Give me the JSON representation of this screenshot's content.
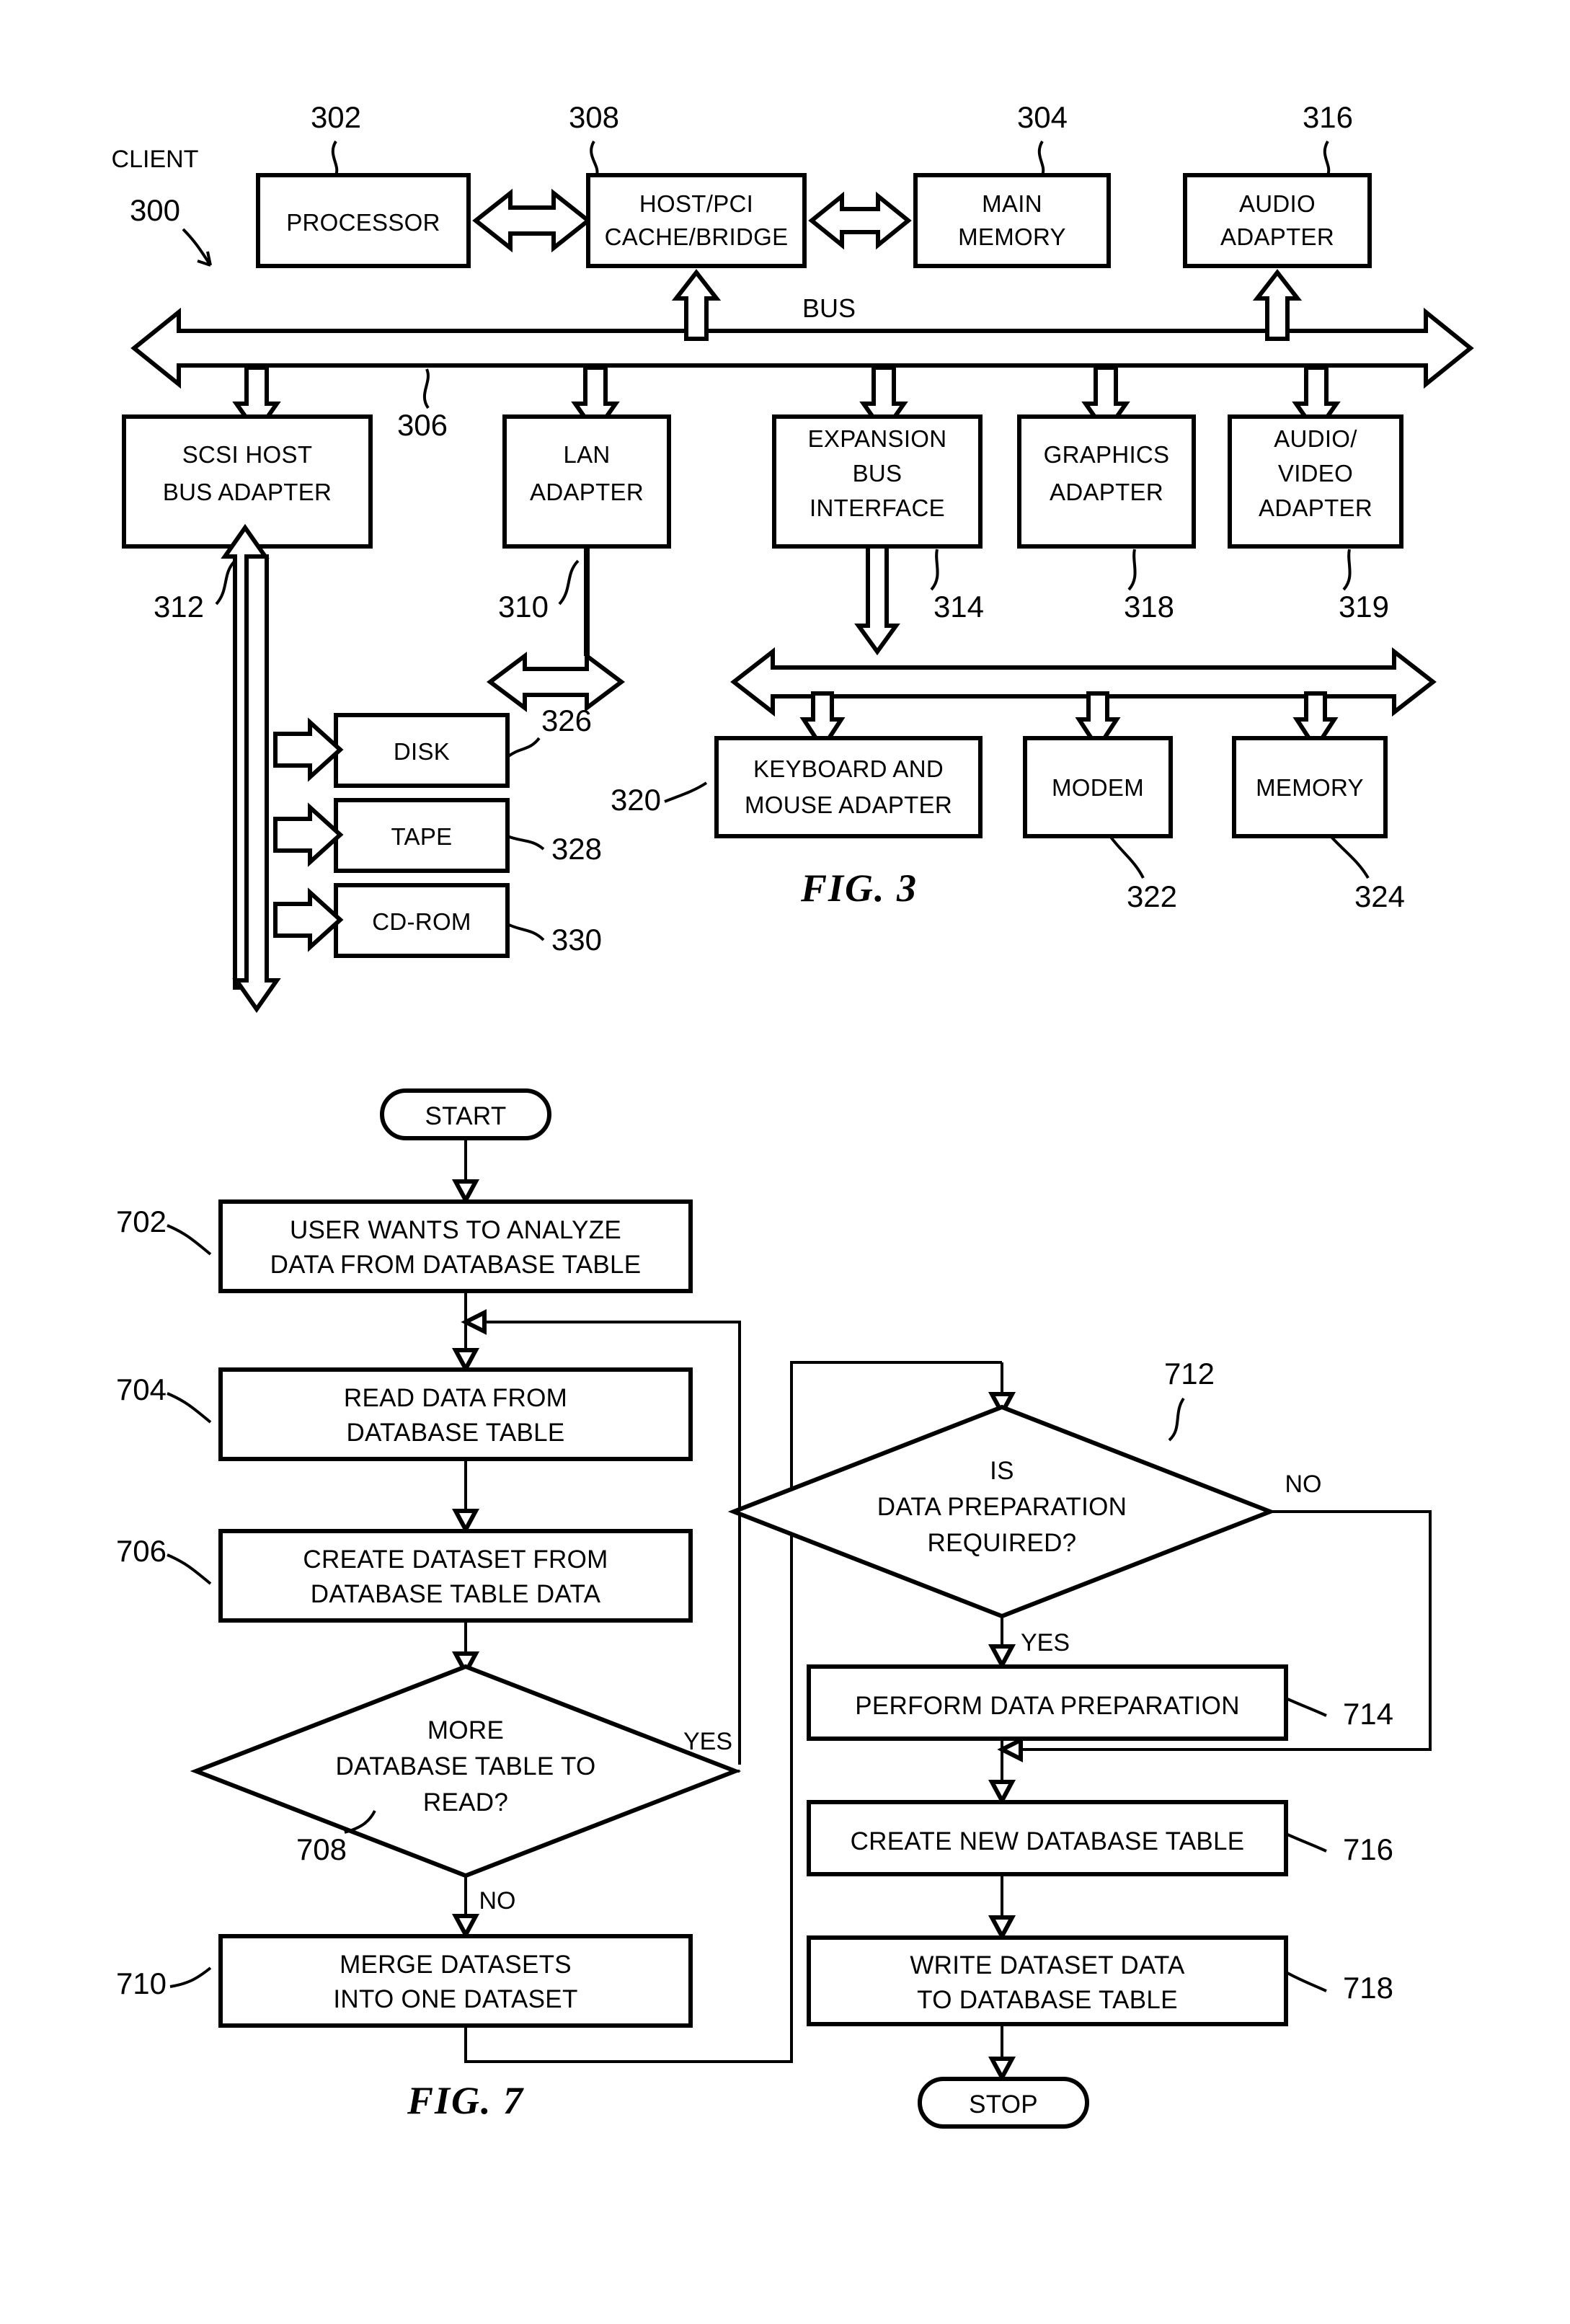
{
  "figures": [
    {
      "id": "fig3",
      "caption": "FIG. 3",
      "system_label": "CLIENT",
      "system_ref": "300",
      "bus_label": "BUS",
      "bus_ref": "306",
      "nodes": [
        {
          "key": "processor",
          "label_lines": [
            "PROCESSOR"
          ],
          "ref": "302"
        },
        {
          "key": "hostpci",
          "label_lines": [
            "HOST/PCI",
            "CACHE/BRIDGE"
          ],
          "ref": "308"
        },
        {
          "key": "mainmemory",
          "label_lines": [
            "MAIN",
            "MEMORY"
          ],
          "ref": "304"
        },
        {
          "key": "audioadapter",
          "label_lines": [
            "AUDIO",
            "ADAPTER"
          ],
          "ref": "316"
        },
        {
          "key": "scsi",
          "label_lines": [
            "SCSI HOST",
            "BUS ADAPTER"
          ],
          "ref": "312"
        },
        {
          "key": "lan",
          "label_lines": [
            "LAN",
            "ADAPTER"
          ],
          "ref": "310"
        },
        {
          "key": "expansion",
          "label_lines": [
            "EXPANSION",
            "BUS",
            "INTERFACE"
          ],
          "ref": "314"
        },
        {
          "key": "graphics",
          "label_lines": [
            "GRAPHICS",
            "ADAPTER"
          ],
          "ref": "318"
        },
        {
          "key": "audiovideo",
          "label_lines": [
            "AUDIO/",
            "VIDEO",
            "ADAPTER"
          ],
          "ref": "319"
        },
        {
          "key": "disk",
          "label_lines": [
            "DISK"
          ],
          "ref": "326"
        },
        {
          "key": "tape",
          "label_lines": [
            "TAPE"
          ],
          "ref": "328"
        },
        {
          "key": "cdrom",
          "label_lines": [
            "CD-ROM"
          ],
          "ref": "330"
        },
        {
          "key": "keyboard",
          "label_lines": [
            "KEYBOARD AND",
            "MOUSE ADAPTER"
          ],
          "ref": "320"
        },
        {
          "key": "modem",
          "label_lines": [
            "MODEM"
          ],
          "ref": "322"
        },
        {
          "key": "memory",
          "label_lines": [
            "MEMORY"
          ],
          "ref": "324"
        }
      ]
    },
    {
      "id": "fig7",
      "caption": "FIG. 7",
      "terminators": {
        "start": "START",
        "stop": "STOP"
      },
      "branch_labels": {
        "yes": "YES",
        "no": "NO"
      },
      "nodes": [
        {
          "key": "step702",
          "shape": "process",
          "label_lines": [
            "USER WANTS TO ANALYZE",
            "DATA FROM DATABASE TABLE"
          ],
          "ref": "702"
        },
        {
          "key": "step704",
          "shape": "process",
          "label_lines": [
            "READ DATA FROM",
            "DATABASE TABLE"
          ],
          "ref": "704"
        },
        {
          "key": "step706",
          "shape": "process",
          "label_lines": [
            "CREATE DATASET FROM",
            "DATABASE TABLE DATA"
          ],
          "ref": "706"
        },
        {
          "key": "step708",
          "shape": "decision",
          "label_lines": [
            "MORE",
            "DATABASE TABLE TO",
            "READ?"
          ],
          "ref": "708"
        },
        {
          "key": "step710",
          "shape": "process",
          "label_lines": [
            "MERGE DATASETS",
            "INTO ONE DATASET"
          ],
          "ref": "710"
        },
        {
          "key": "step712",
          "shape": "decision",
          "label_lines": [
            "IS",
            "DATA PREPARATION",
            "REQUIRED?"
          ],
          "ref": "712"
        },
        {
          "key": "step714",
          "shape": "process",
          "label_lines": [
            "PERFORM DATA PREPARATION"
          ],
          "ref": "714"
        },
        {
          "key": "step716",
          "shape": "process",
          "label_lines": [
            "CREATE NEW DATABASE TABLE"
          ],
          "ref": "716"
        },
        {
          "key": "step718",
          "shape": "process",
          "label_lines": [
            "WRITE DATASET DATA",
            "TO DATABASE TABLE"
          ],
          "ref": "718"
        }
      ]
    }
  ],
  "colors": {
    "ink": "#000000",
    "paper": "#ffffff"
  }
}
